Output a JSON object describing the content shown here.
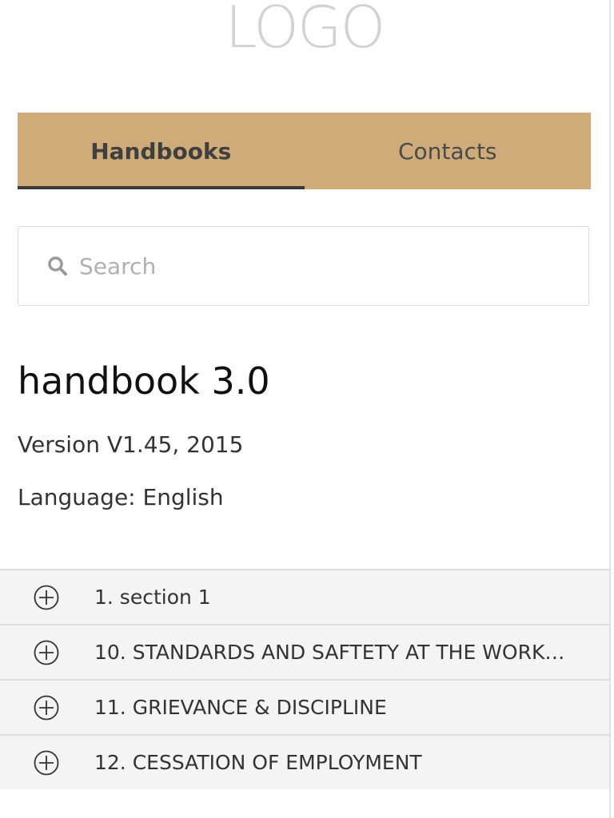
{
  "logo": {
    "text": "LOGO"
  },
  "tabs": [
    {
      "label": "Handbooks",
      "active": true
    },
    {
      "label": "Contacts",
      "active": false
    }
  ],
  "search": {
    "placeholder": "Search",
    "value": ""
  },
  "handbook": {
    "title": "handbook 3.0",
    "version": "Version V1.45, 2015",
    "language": "Language: English"
  },
  "sections": [
    {
      "label": "1. section 1"
    },
    {
      "label": "10. STANDARDS AND SAFTETY AT THE WORKPL…"
    },
    {
      "label": "11. GRIEVANCE & DISCIPLINE"
    },
    {
      "label": "12. CESSATION OF EMPLOYMENT"
    }
  ],
  "colors": {
    "tab_bar": "#cfab79",
    "tab_indicator": "#3a3a3a",
    "section_bg": "#f4f4f4",
    "logo": "#d2d2d2"
  },
  "icons": {
    "search": "search-icon",
    "expand": "plus-circle-icon"
  }
}
